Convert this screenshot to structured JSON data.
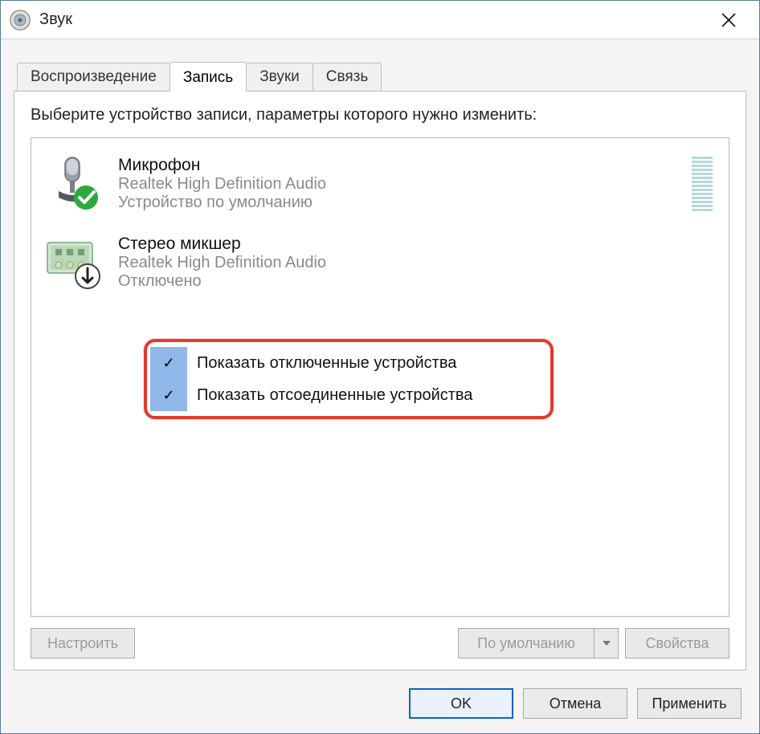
{
  "window": {
    "title": "Звук"
  },
  "tabs": [
    {
      "label": "Воспроизведение",
      "active": false
    },
    {
      "label": "Запись",
      "active": true
    },
    {
      "label": "Звуки",
      "active": false
    },
    {
      "label": "Связь",
      "active": false
    }
  ],
  "panel": {
    "instruction": "Выберите устройство записи, параметры которого нужно изменить:",
    "devices": [
      {
        "name": "Микрофон",
        "driver": "Realtek High Definition Audio",
        "status": "Устройство по умолчанию",
        "badge": "default"
      },
      {
        "name": "Стерео микшер",
        "driver": "Realtek High Definition Audio",
        "status": "Отключено",
        "badge": "disabled"
      }
    ],
    "context_menu": [
      {
        "label": "Показать отключенные устройства",
        "checked": true
      },
      {
        "label": "Показать отсоединенные устройства",
        "checked": true
      }
    ],
    "buttons": {
      "configure": "Настроить",
      "set_default": "По умолчанию",
      "properties": "Свойства"
    }
  },
  "footer": {
    "ok": "OK",
    "cancel": "Отмена",
    "apply": "Применить"
  }
}
